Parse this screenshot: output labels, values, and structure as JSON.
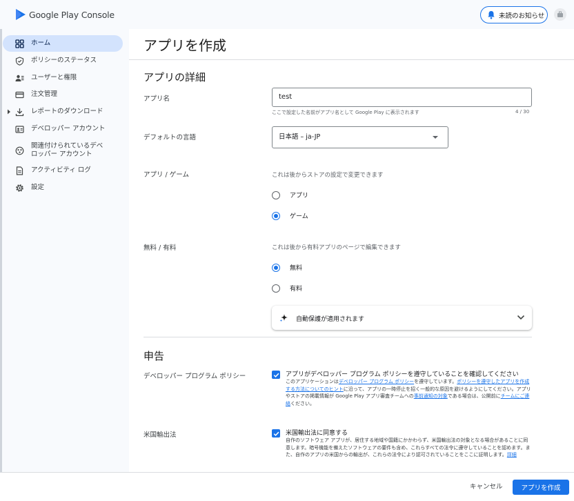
{
  "header": {
    "brand": "Google Play Console",
    "notice_label": "未読のお知らせ"
  },
  "sidebar": {
    "items": [
      {
        "label": "ホーム",
        "icon": "grid-icon",
        "active": true
      },
      {
        "label": "ポリシーのステータス",
        "icon": "shield-icon"
      },
      {
        "label": "ユーザーと権限",
        "icon": "users-icon"
      },
      {
        "label": "注文管理",
        "icon": "credit-card-icon"
      },
      {
        "label": "レポートのダウンロード",
        "icon": "download-icon"
      },
      {
        "label": "デベロッパー アカウント",
        "icon": "id-card-icon"
      },
      {
        "label_line1": "関連付けられているデベ",
        "label_line2": "ロッパー アカウント",
        "icon": "linked-accounts-icon"
      },
      {
        "label": "アクティビティ ログ",
        "icon": "document-icon"
      },
      {
        "label": "設定",
        "icon": "gear-icon"
      }
    ]
  },
  "main": {
    "page_title": "アプリを作成",
    "details": {
      "section_title": "アプリの詳細",
      "app_name_label": "アプリ名",
      "app_name_value": "test",
      "app_name_helper": "ここで設定した名前がアプリ名として Google Play に表示されます",
      "app_name_counter": "4 / 30",
      "language_label": "デフォルトの言語",
      "language_value": "日本語 – ja-JP",
      "app_or_game_label": "アプリ / ゲーム",
      "app_or_game_hint": "これは後からストアの設定で変更できます",
      "app_option": "アプリ",
      "game_option": "ゲーム",
      "app_or_game_selected": "ゲーム",
      "free_paid_label": "無料 / 有料",
      "free_paid_hint": "これは後から有料アプリのページで編集できます",
      "free_option": "無料",
      "paid_option": "有料",
      "free_paid_selected": "無料",
      "auto_protection_text": "自動保護が適用されます"
    },
    "declarations": {
      "section_title": "申告",
      "dev_policy_label": "デベロッパー プログラム ポリシー",
      "dev_policy_checked": true,
      "dev_policy_title": "アプリがデベロッパー プログラム ポリシーを遵守していることを確認してください",
      "dev_policy_text_1": "このアプリケーションは",
      "dev_policy_link_1": "デベロッパー プログラム ポリシー",
      "dev_policy_text_2": "を遵守しています。",
      "dev_policy_link_2": "ポリシーを遵守したアプリを作成する方法についてのヒント",
      "dev_policy_text_3": "に沿って、アプリの一時停止を招く一般的な原因を避けるようにしてください。アプリやストアの掲載情報が Google Play アプリ審査チームへの",
      "dev_policy_link_3": "事前通知の対象",
      "dev_policy_text_4": "である場合は、公開前に",
      "dev_policy_link_4": "チームにご連絡",
      "dev_policy_text_5": "ください。",
      "export_label": "米国輸出法",
      "export_checked": true,
      "export_title": "米国輸出法に同意する",
      "export_text": "自作のソフトウェア アプリが、居住する地域や国籍にかかわらず、米国輸出法の対象となる場合があることに同意します。暗号機能を備えたソフトウェアの要件も含め、これらすべての法令に遵守していることを認めます。また、自作のアプリの米国からの輸出が、これらの法令により認可されていることをここに証明します。",
      "export_link": "詳細"
    }
  },
  "footer": {
    "cancel_label": "キャンセル",
    "create_label": "アプリを作成"
  },
  "colors": {
    "accent": "#1a73e8",
    "active_nav_bg": "#d3e3fd",
    "sidebar_bg": "#f8fafd"
  }
}
